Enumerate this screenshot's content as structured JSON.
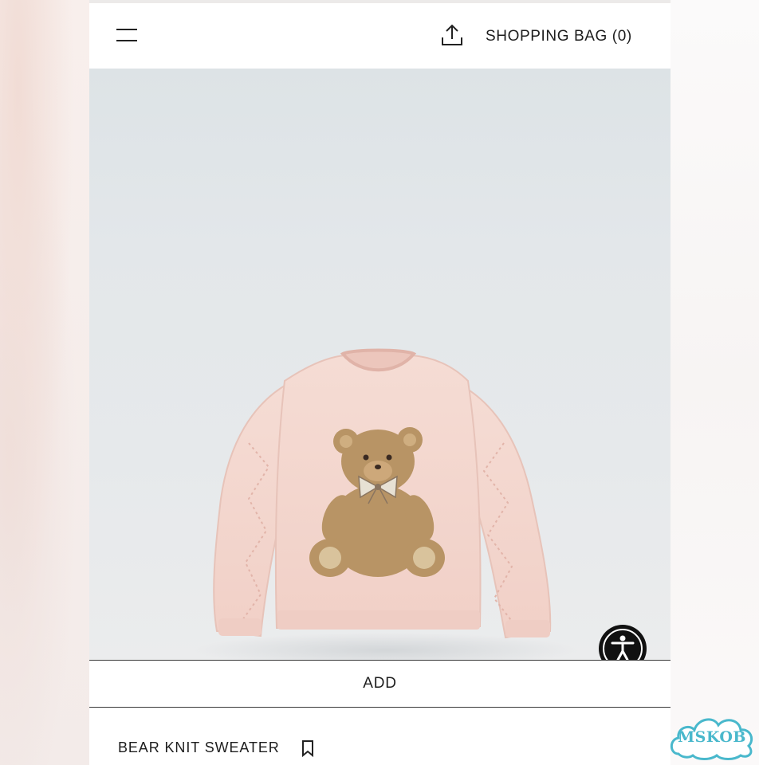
{
  "header": {
    "menu_icon": "hamburger-menu-icon",
    "share_icon": "share-upload-icon",
    "shopping_bag_label": "SHOPPING BAG (0)"
  },
  "product": {
    "image_description_icon": "product-photo",
    "add_label": "ADD",
    "name": "BEAR KNIT SWEATER",
    "bookmark_icon": "bookmark-icon"
  },
  "accessibility": {
    "icon": "accessibility-icon"
  },
  "watermark": {
    "text": "MSKOB"
  },
  "colors": {
    "accent": "#111111",
    "sweater": "#f3d6cf",
    "bear": "#b89465",
    "watermark": "#49b8cc"
  }
}
